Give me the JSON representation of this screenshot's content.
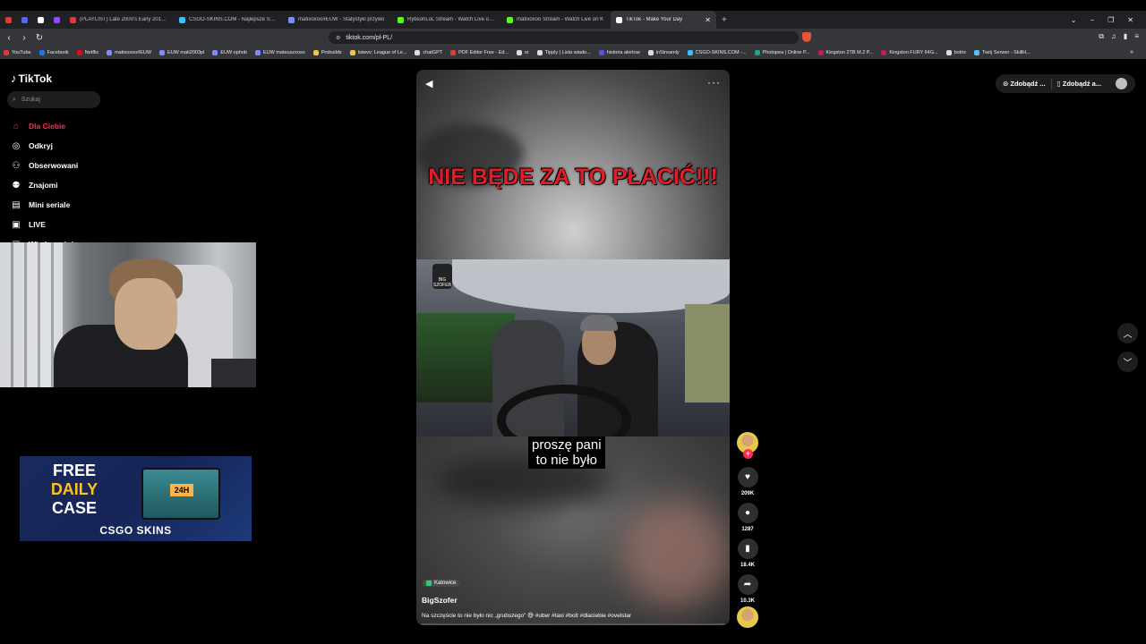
{
  "browser": {
    "tabs": [
      {
        "title": "",
        "color": "#e53935"
      },
      {
        "title": "",
        "color": "#5865f2"
      },
      {
        "title": "",
        "color": "#ffffff"
      },
      {
        "title": "",
        "color": "#9146ff"
      },
      {
        "title": "(PLAYLIST) Late 2000's Early 2010's m",
        "color": "#e53935"
      },
      {
        "title": "CSGO-SKINS.COM - Najlepsze Skrzy",
        "color": "#34c3ff"
      },
      {
        "title": "matixoxoo#EUW - Statystyki przywo",
        "color": "#7b8cff"
      },
      {
        "title": "RybsonLoL Stream - Watch Live on K",
        "color": "#53fc18"
      },
      {
        "title": "matixoxoo Stream - Watch Live on K",
        "color": "#53fc18"
      },
      {
        "title": "TikTok - Make Your Day",
        "color": "#ffffff"
      }
    ],
    "new_tab": "+",
    "url": "tiktok.com/pl-PL/",
    "bookmarks": [
      {
        "label": "YouTube",
        "color": "#e53935"
      },
      {
        "label": "Facebook",
        "color": "#1877f2"
      },
      {
        "label": "Netflix",
        "color": "#e50914"
      },
      {
        "label": "matixoxoo#EUW",
        "color": "#7b8cff"
      },
      {
        "label": "EUW mati2003pl",
        "color": "#7b8cff"
      },
      {
        "label": "EUW ophob",
        "color": "#7b8cff"
      },
      {
        "label": "EUW mateuszxoxo",
        "color": "#7b8cff"
      },
      {
        "label": "Probuilds",
        "color": "#f4c542"
      },
      {
        "label": "loiwvv: League of Le...",
        "color": "#f4c542"
      },
      {
        "label": "chatGPT",
        "color": "#dddddd"
      },
      {
        "label": "PDF Editor Free - Ed...",
        "color": "#e53935"
      },
      {
        "label": "sr",
        "color": "#dddddd"
      },
      {
        "label": "Tipply | Lista wiado...",
        "color": "#dddddd"
      },
      {
        "label": "historia alertow",
        "color": "#5c4ee5"
      },
      {
        "label": "inStreamly",
        "color": "#dddddd"
      },
      {
        "label": "CSGO-SKINS.COM -...",
        "color": "#34c3ff"
      },
      {
        "label": "Photopea | Online P...",
        "color": "#18a497"
      },
      {
        "label": "Kingston 2TB M.2 P...",
        "color": "#c2185b"
      },
      {
        "label": "Kingston FURY 64G...",
        "color": "#c2185b"
      },
      {
        "label": "botrix",
        "color": "#dddddd"
      },
      {
        "label": "Twój Serwer - SkillH...",
        "color": "#4fc3f7"
      }
    ]
  },
  "tiktok": {
    "logo": "TikTok",
    "search_placeholder": "Szukaj",
    "nav": [
      {
        "label": "Dla Ciebie",
        "icon": "home-icon",
        "glyph": "⌂"
      },
      {
        "label": "Odkryj",
        "icon": "compass-icon",
        "glyph": "◎"
      },
      {
        "label": "Obserwowani",
        "icon": "user-follow-icon",
        "glyph": "⚇"
      },
      {
        "label": "Znajomi",
        "icon": "friends-icon",
        "glyph": "⚉"
      },
      {
        "label": "Mini seriale",
        "icon": "series-icon",
        "glyph": "▤"
      },
      {
        "label": "LIVE",
        "icon": "live-icon",
        "glyph": "▣"
      },
      {
        "label": "Wiadomości",
        "icon": "messages-icon",
        "glyph": "▽"
      }
    ],
    "top_right": {
      "btn1": "Zdobądź ...",
      "btn2": "Zdobądź a..."
    },
    "video": {
      "headline": "NIE BĘDE ZA TO PŁACIĆ!!!",
      "badge": "BIG SZOFER",
      "subtitle_line1": "proszę pani",
      "subtitle_line2": "to nie było",
      "location": "Katowice",
      "author": "BigSzofer",
      "caption": "Na szczęście to nie było nic „grubszego” 😅 #uber #taxi #bolt #dlaciebie #ovelstar",
      "progress": 0
    },
    "actions": {
      "likes": "209K",
      "comments": "1287",
      "saves": "18.4K",
      "shares": "10.3K"
    }
  },
  "promo": {
    "line1": "FREE",
    "line2": "DAILY",
    "line3": "CASE",
    "chest_label": "24H",
    "brand": "CSGO SKINS"
  }
}
